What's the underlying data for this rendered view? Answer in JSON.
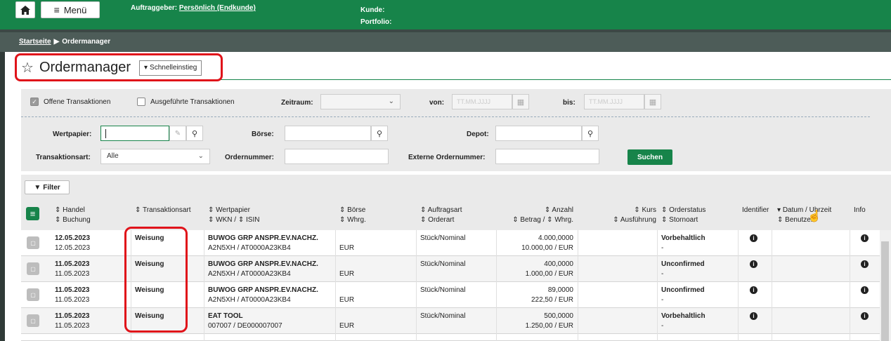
{
  "topbar": {
    "menu_label": "Menü",
    "auftraggeber_label": "Auftraggeber:",
    "auftraggeber_value": "Persönlich (Endkunde)",
    "kunde_label": "Kunde:",
    "portfolio_label": "Portfolio:"
  },
  "breadcrumb": {
    "home": "Startseite",
    "current": "Ordermanager"
  },
  "page": {
    "title": "Ordermanager",
    "quick_entry": "Schnelleinstieg"
  },
  "filters": {
    "open_tx": "Offene Transaktionen",
    "done_tx": "Ausgeführte Transaktionen",
    "zeitraum": "Zeitraum:",
    "von": "von:",
    "bis": "bis:",
    "date_placeholder": "TT.MM.JJJJ",
    "wertpapier": "Wertpapier:",
    "boerse": "Börse:",
    "depot": "Depot:",
    "transaktionsart": "Transaktionsart:",
    "transaktionsart_value": "Alle",
    "ordernummer": "Ordernummer:",
    "externe_ordernummer": "Externe Ordernummer:",
    "search_button": "Suchen"
  },
  "table": {
    "filter_button": "Filter",
    "headers": {
      "handel": "Handel",
      "buchung": "Buchung",
      "transaktionsart": "Transaktionsart",
      "wertpapier": "Wertpapier",
      "wkn": "WKN /",
      "isin": "ISIN",
      "boerse": "Börse",
      "whrg": "Whrg.",
      "auftragsart": "Auftragsart",
      "orderart": "Orderart",
      "anzahl": "Anzahl",
      "betrag": "Betrag /",
      "betrag_whrg": "Whrg.",
      "kurs": "Kurs",
      "ausfuehrung": "Ausführung",
      "orderstatus": "Orderstatus",
      "stornoart": "Stornoart",
      "identifier": "Identifier",
      "datum": "Datum / Uhrzeit",
      "benutzer": "Benutzer",
      "info": "Info"
    },
    "rows": [
      {
        "handel": "12.05.2023",
        "buchung": "12.05.2023",
        "tx": "Weisung",
        "name": "BUWOG GRP ANSPR.EV.NACHZ.",
        "wkn_isin": "A2N5XH / AT0000A23KB4",
        "whrg": "EUR",
        "auftragsart": "Stück/Nominal",
        "anzahl": "4.000,0000",
        "betrag": "10.000,00 / EUR",
        "status": "Vorbehaltlich",
        "storno": "-"
      },
      {
        "handel": "11.05.2023",
        "buchung": "11.05.2023",
        "tx": "Weisung",
        "name": "BUWOG GRP ANSPR.EV.NACHZ.",
        "wkn_isin": "A2N5XH / AT0000A23KB4",
        "whrg": "EUR",
        "auftragsart": "Stück/Nominal",
        "anzahl": "400,0000",
        "betrag": "1.000,00 / EUR",
        "status": "Unconfirmed",
        "storno": "-"
      },
      {
        "handel": "11.05.2023",
        "buchung": "11.05.2023",
        "tx": "Weisung",
        "name": "BUWOG GRP ANSPR.EV.NACHZ.",
        "wkn_isin": "A2N5XH / AT0000A23KB4",
        "whrg": "EUR",
        "auftragsart": "Stück/Nominal",
        "anzahl": "89,0000",
        "betrag": "222,50 / EUR",
        "status": "Unconfirmed",
        "storno": "-"
      },
      {
        "handel": "11.05.2023",
        "buchung": "11.05.2023",
        "tx": "Weisung",
        "name": "EAT TOOL",
        "wkn_isin": "007007 / DE000007007",
        "whrg": "EUR",
        "auftragsart": "Stück/Nominal",
        "anzahl": "500,0000",
        "betrag": "1.250,00 / EUR",
        "status": "Vorbehaltlich",
        "storno": "-"
      }
    ]
  }
}
